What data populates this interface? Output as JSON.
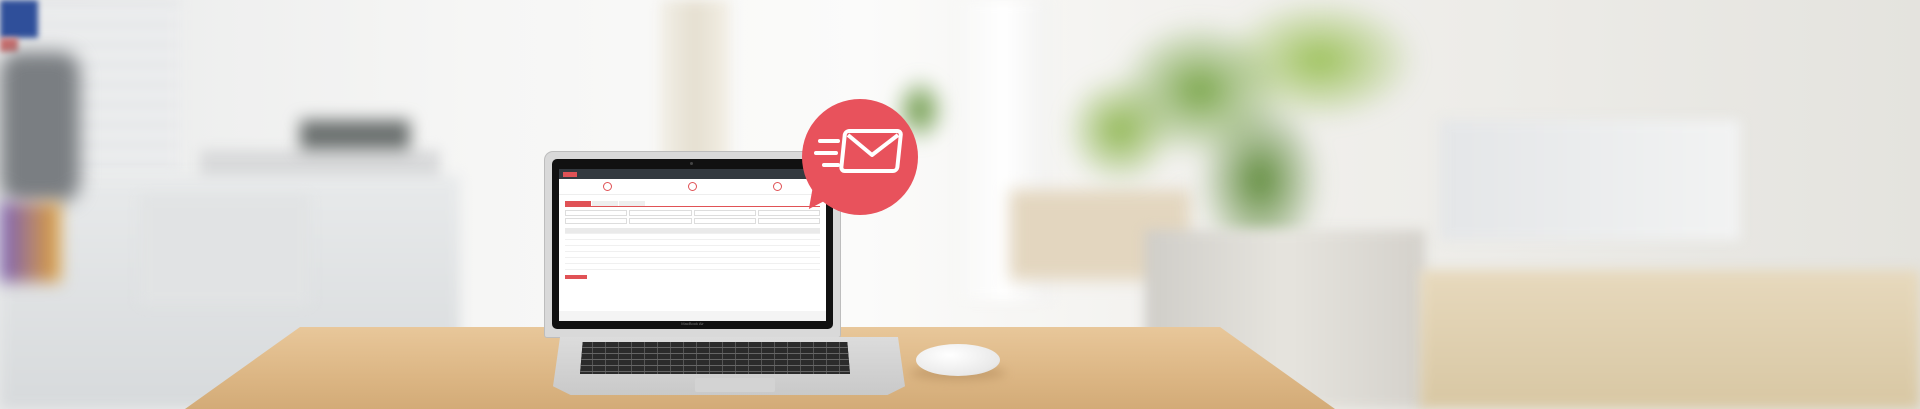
{
  "laptop": {
    "brand_label": "MacBook Air"
  },
  "icons": {
    "mail": "mail-send-icon"
  },
  "colors": {
    "accent": "#e8525c",
    "nav": "#343a40",
    "table": "#dcb684"
  }
}
